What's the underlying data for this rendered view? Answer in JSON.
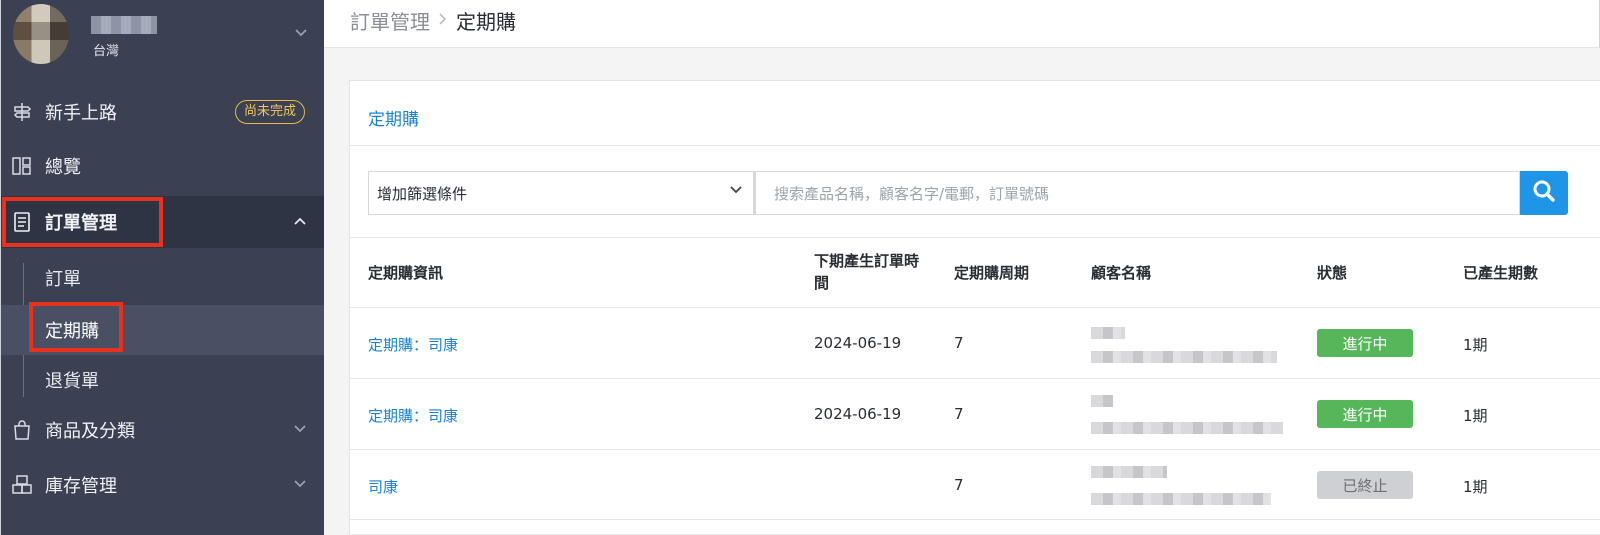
{
  "account": {
    "region": "台灣"
  },
  "sidebar": {
    "items": [
      {
        "label": "新手上路",
        "badge": "尚未完成",
        "icon": "signpost-icon"
      },
      {
        "label": "總覽",
        "icon": "dashboard-icon"
      },
      {
        "label": "訂單管理",
        "icon": "document-icon",
        "expanded": true
      },
      {
        "label": "商品及分類",
        "icon": "shopping-bag-icon"
      },
      {
        "label": "庫存管理",
        "icon": "boxes-icon"
      }
    ],
    "sub_items": [
      {
        "label": "訂單"
      },
      {
        "label": "定期購",
        "active": true
      },
      {
        "label": "退貨單"
      }
    ]
  },
  "breadcrumb": {
    "parent": "訂單管理",
    "current": "定期購"
  },
  "card": {
    "title": "定期購",
    "filter_label": "增加篩選條件",
    "search_placeholder": "搜索產品名稱，顧客名字/電郵，訂單號碼"
  },
  "table": {
    "headers": [
      "定期購資訊",
      "下期產生訂單時間",
      "定期購周期",
      "顧客名稱",
      "狀態",
      "已產生期數"
    ],
    "rows": [
      {
        "info": "定期購：司康",
        "next": "2024-06-19",
        "cycle": "7",
        "status": "進行中",
        "status_type": "on",
        "periods": "1期"
      },
      {
        "info": "定期購：司康",
        "next": "2024-06-19",
        "cycle": "7",
        "status": "進行中",
        "status_type": "on",
        "periods": "1期"
      },
      {
        "info": "司康",
        "next": "",
        "cycle": "7",
        "status": "已終止",
        "status_type": "off",
        "periods": "1期"
      }
    ]
  },
  "colors": {
    "sidebar_bg": "#3b4153",
    "accent": "#1b82d2",
    "highlight": "#e8321e",
    "status_on": "#56b65a",
    "status_off": "#cfd0d3"
  }
}
